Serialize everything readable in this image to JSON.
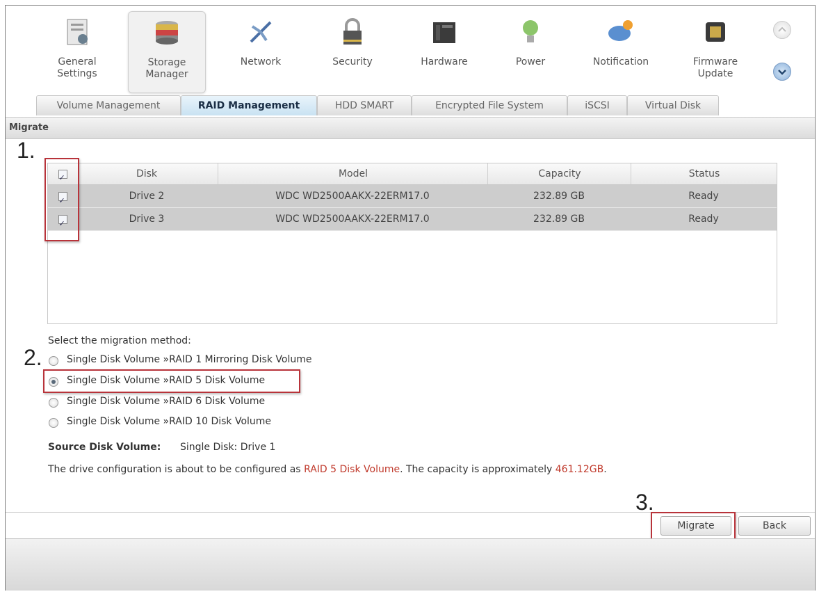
{
  "toolbar": {
    "items": [
      {
        "label": "General Settings",
        "line1": "General",
        "line2": "Settings",
        "icon": "general-settings-icon"
      },
      {
        "label": "Storage Manager",
        "line1": "Storage",
        "line2": "Manager",
        "icon": "storage-manager-icon"
      },
      {
        "label": "Network",
        "line1": "Network",
        "line2": "",
        "icon": "network-icon"
      },
      {
        "label": "Security",
        "line1": "Security",
        "line2": "",
        "icon": "lock-icon"
      },
      {
        "label": "Hardware",
        "line1": "Hardware",
        "line2": "",
        "icon": "hardware-icon"
      },
      {
        "label": "Power",
        "line1": "Power",
        "line2": "",
        "icon": "power-bulb-icon"
      },
      {
        "label": "Notification",
        "line1": "Notification",
        "line2": "",
        "icon": "notification-icon"
      },
      {
        "label": "Firmware Update",
        "line1": "Firmware",
        "line2": "Update",
        "icon": "firmware-chip-icon"
      }
    ],
    "active": "Storage Manager"
  },
  "tabs": [
    {
      "label": "Volume Management"
    },
    {
      "label": "RAID Management"
    },
    {
      "label": "HDD SMART"
    },
    {
      "label": "Encrypted File System"
    },
    {
      "label": "iSCSI"
    },
    {
      "label": "Virtual Disk"
    }
  ],
  "active_tab": "RAID Management",
  "section_title": "Migrate",
  "steps": {
    "one": "1.",
    "two": "2.",
    "three": "3."
  },
  "table": {
    "columns": [
      "Disk",
      "Model",
      "Capacity",
      "Status"
    ],
    "rows": [
      {
        "checked": true,
        "disk": "Drive 2",
        "model": "WDC WD2500AAKX-22ERM17.0",
        "capacity": "232.89 GB",
        "status": "Ready"
      },
      {
        "checked": true,
        "disk": "Drive 3",
        "model": "WDC WD2500AAKX-22ERM17.0",
        "capacity": "232.89 GB",
        "status": "Ready"
      }
    ],
    "header_checked": true
  },
  "migration": {
    "prompt": "Select the migration method:",
    "options": [
      {
        "label": "Single Disk Volume »RAID 1 Mirroring Disk Volume",
        "selected": false
      },
      {
        "label": "Single Disk Volume »RAID 5 Disk Volume",
        "selected": true
      },
      {
        "label": "Single Disk Volume »RAID 6 Disk Volume",
        "selected": false
      },
      {
        "label": "Single Disk Volume »RAID 10 Disk Volume",
        "selected": false
      }
    ]
  },
  "source": {
    "label": "Source Disk Volume:",
    "value": "Single Disk: Drive 1"
  },
  "summary": {
    "prefix": "The drive configuration is about to be configured as ",
    "raid": "RAID 5 Disk Volume",
    "middle": ". The capacity is approximately ",
    "capacity": "461.12GB",
    "suffix": "."
  },
  "buttons": {
    "migrate": "Migrate",
    "back": "Back"
  },
  "colors": {
    "highlight_red": "#b8333a",
    "active_tab": "#c9e2f2"
  }
}
